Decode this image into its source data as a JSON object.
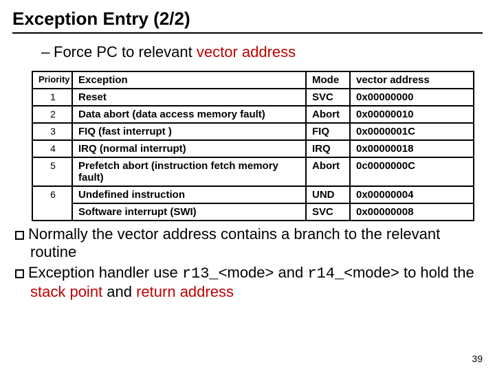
{
  "title": "Exception Entry (2/2)",
  "subbullet_prefix": "–",
  "subbullet_text_1": "Force PC to relevant ",
  "subbullet_text_2": "vector address",
  "table": {
    "headers": {
      "priority": "Priority",
      "exception": "Exception",
      "mode": "Mode",
      "vector": "vector address"
    },
    "rows": [
      {
        "pri": "1",
        "exc": "Reset",
        "mode": "SVC",
        "addr": "0x00000000"
      },
      {
        "pri": "2",
        "exc": "Data abort (data access memory fault)",
        "mode": "Abort",
        "addr": "0x00000010"
      },
      {
        "pri": "3",
        "exc": "FIQ (fast interrupt )",
        "mode": "FIQ",
        "addr": "0x0000001C"
      },
      {
        "pri": "4",
        "exc": "IRQ (normal interrupt)",
        "mode": "IRQ",
        "addr": "0x00000018"
      },
      {
        "pri": "5",
        "exc": "Prefetch abort (instruction fetch memory fault)",
        "mode": "Abort",
        "addr": "0c0000000C"
      },
      {
        "pri": "6",
        "exc": "Undefined instruction",
        "mode": "UND",
        "addr": "0x00000004"
      },
      {
        "pri": "",
        "exc": "Software interrupt (SWI)",
        "mode": "SVC",
        "addr": "0x00000008"
      }
    ]
  },
  "bullets": {
    "b1": "Normally the vector address contains a branch to the relevant routine",
    "b2_a": "Exception handler use ",
    "b2_r13": "r13_",
    "b2_mode1": "<mode>",
    "b2_and": " and ",
    "b2_r14": "r14_",
    "b2_mode2": "<mode>",
    "b2_b": " to hold the ",
    "b2_stack": "stack point",
    "b2_c": " and ",
    "b2_ret": "return address"
  },
  "pagenum": "39"
}
